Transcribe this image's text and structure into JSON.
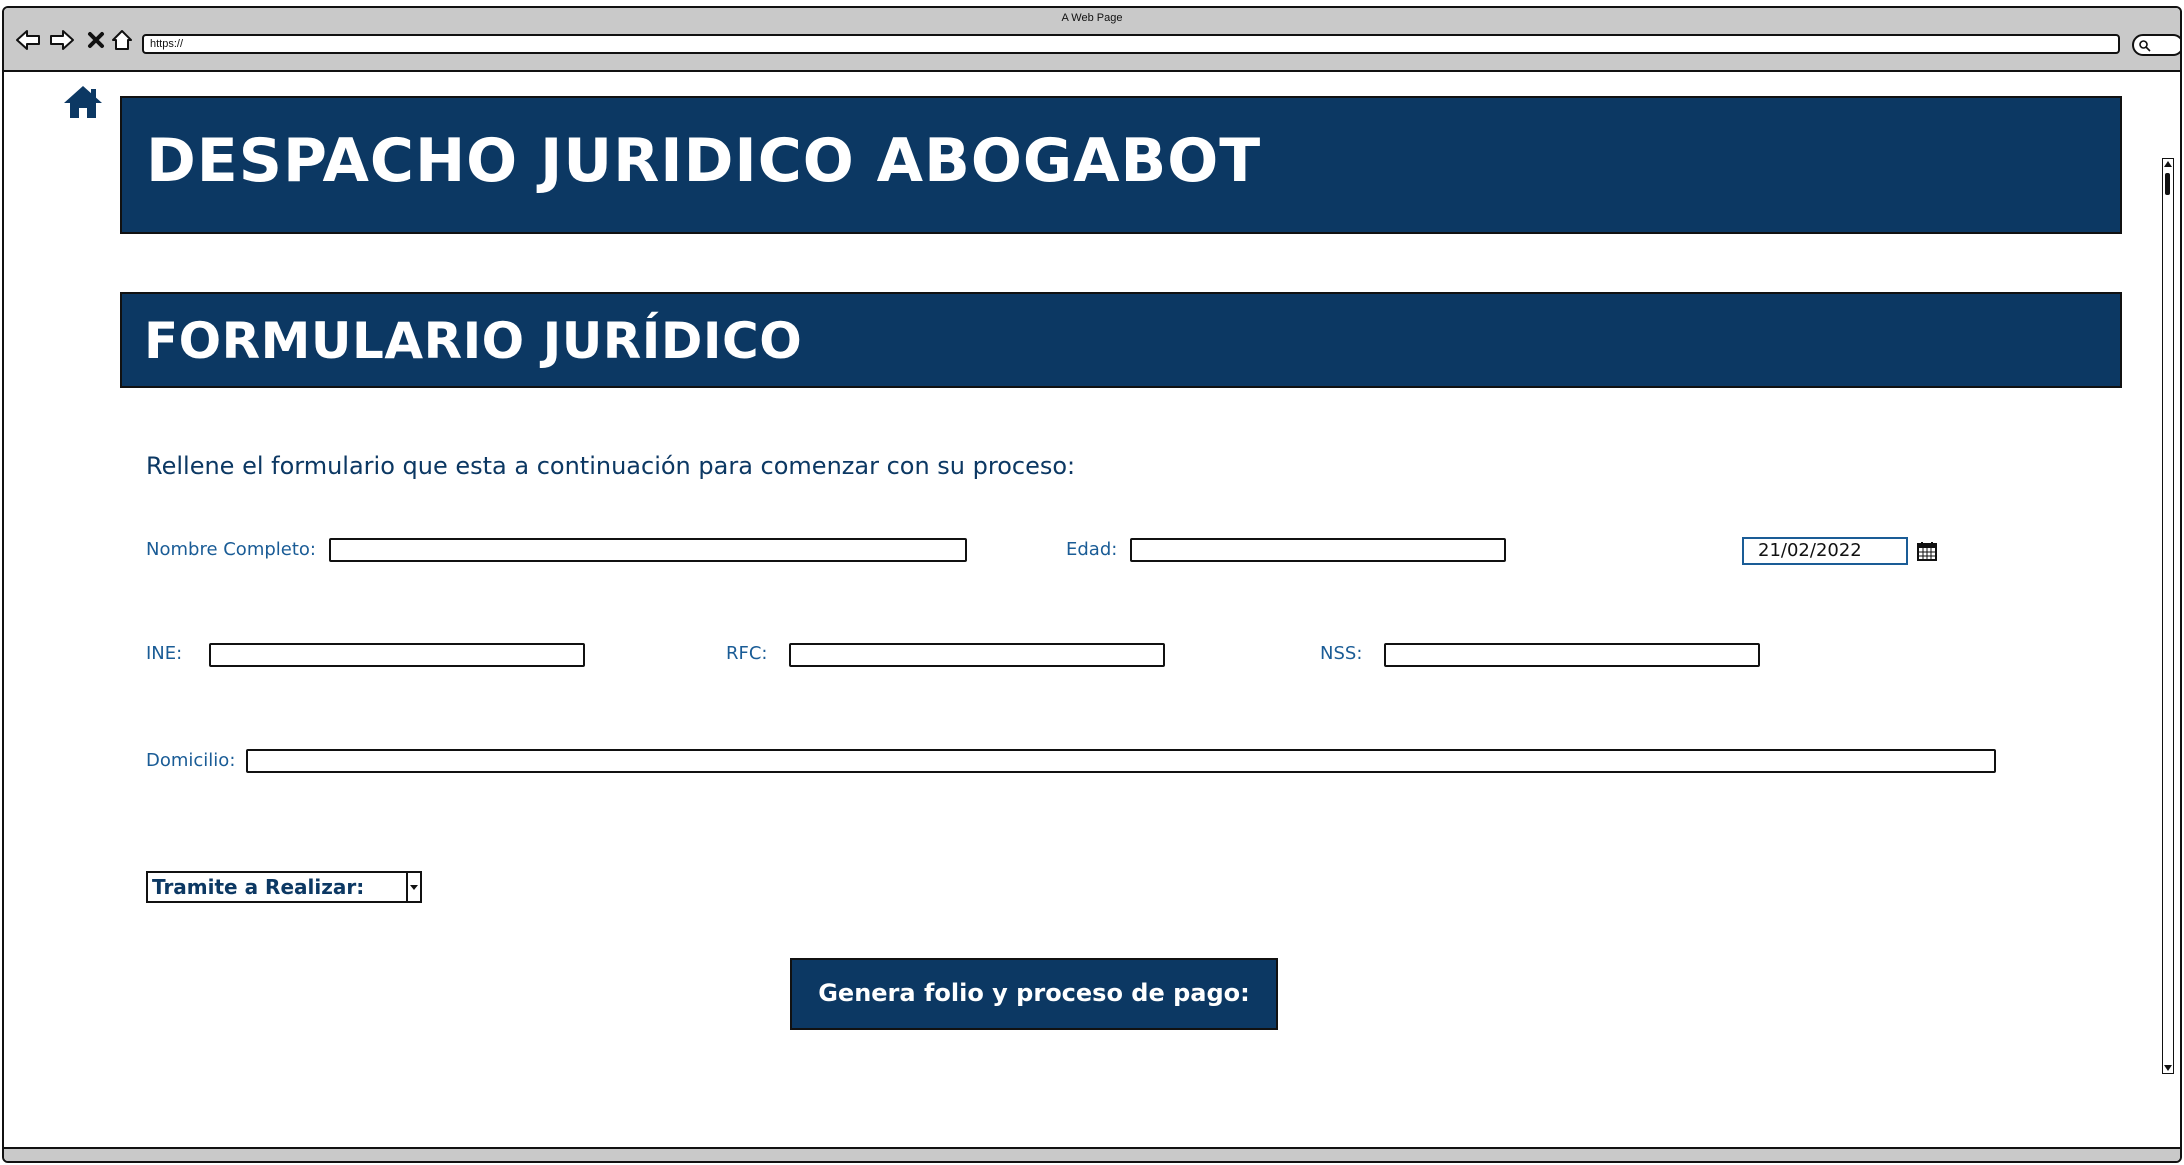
{
  "browser": {
    "window_title": "A Web Page",
    "url": "https://"
  },
  "page": {
    "brand_title": "DESPACHO JURIDICO ABOGABOT",
    "form_title": "FORMULARIO JURÍDICO",
    "intro": "Rellene el formulario que esta a continuación para comenzar con su proceso:"
  },
  "form": {
    "nombre": {
      "label": "Nombre Completo:",
      "value": ""
    },
    "edad": {
      "label": "Edad:",
      "value": ""
    },
    "fecha": {
      "value": "21/02/2022"
    },
    "ine": {
      "label": "INE:",
      "value": ""
    },
    "rfc": {
      "label": "RFC:",
      "value": ""
    },
    "nss": {
      "label": "NSS:",
      "value": ""
    },
    "domicilio": {
      "label": "Domicilio:",
      "value": ""
    },
    "tramite": {
      "selected": "Tramite a Realizar:"
    },
    "submit_label": "Genera folio y proceso de pago:"
  },
  "icons": {
    "back": "back-arrow-icon",
    "forward": "forward-arrow-icon",
    "stop": "close-icon",
    "home": "home-icon",
    "search": "search-icon",
    "calendar": "calendar-icon"
  },
  "colors": {
    "banner": "#0c3863",
    "label": "#1a5c96",
    "chrome": "#c9c9c9"
  }
}
